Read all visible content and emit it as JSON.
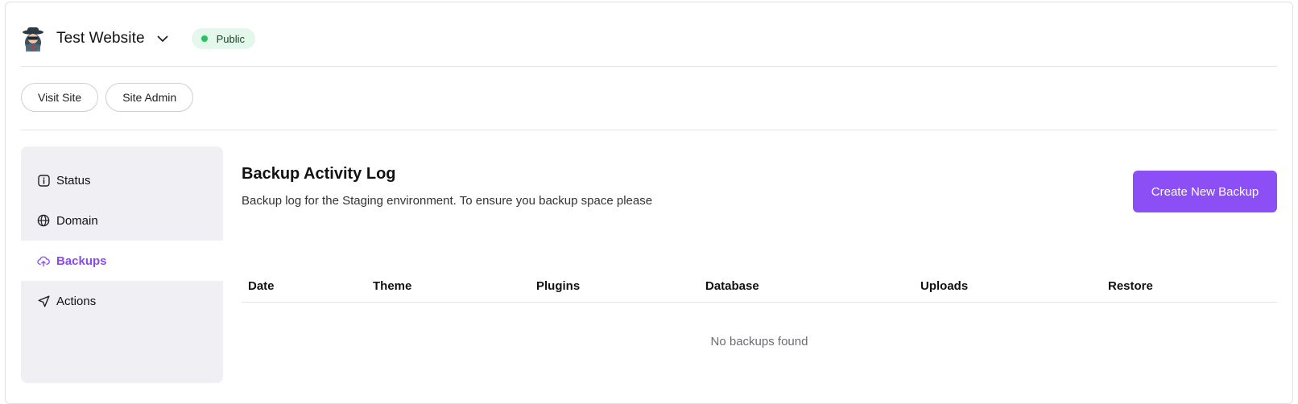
{
  "header": {
    "site_name": "Test Website",
    "visibility": "Public",
    "visibility_color": "#22c55e",
    "avatar_icon": "spy-avatar-icon",
    "switcher_icon": "chevron-down-icon"
  },
  "links": {
    "visit_site": "Visit Site",
    "site_admin": "Site Admin"
  },
  "sidebar": {
    "items": [
      {
        "label": "Status",
        "icon": "info-square-icon",
        "active": false
      },
      {
        "label": "Domain",
        "icon": "globe-icon",
        "active": false
      },
      {
        "label": "Backups",
        "icon": "cloud-upload-icon",
        "active": true
      },
      {
        "label": "Actions",
        "icon": "send-icon",
        "active": false
      }
    ]
  },
  "main": {
    "title": "Backup Activity Log",
    "subtitle": "Backup log for the Staging environment. To ensure you backup space please",
    "create_button": "Create New Backup",
    "accent_color": "#8c4ff6",
    "table": {
      "columns": [
        "Date",
        "Theme",
        "Plugins",
        "Database",
        "Uploads",
        "Restore"
      ],
      "empty_message": "No backups found"
    }
  }
}
